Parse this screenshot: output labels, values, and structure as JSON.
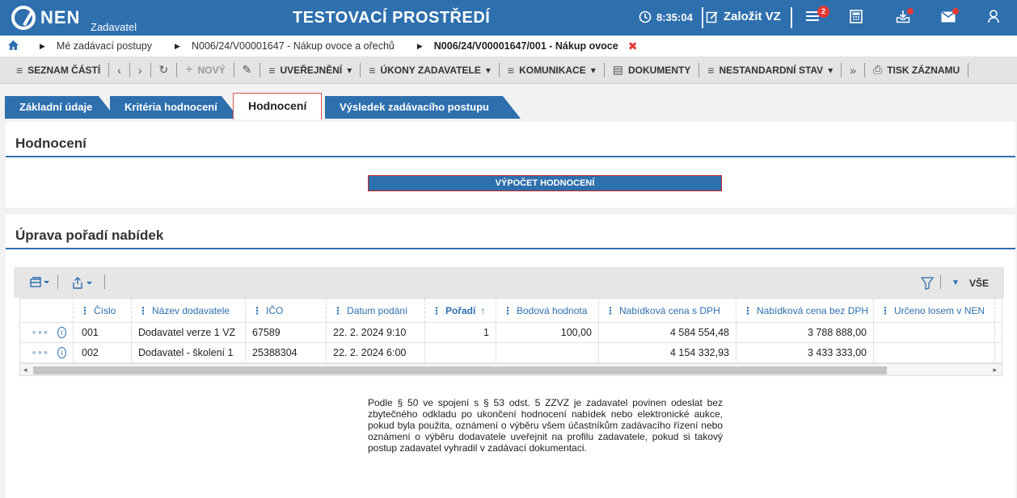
{
  "header": {
    "logo_text": "NEN",
    "logo_sub": "Zadavatel",
    "env_title": "TESTOVACÍ PROSTŘEDÍ",
    "clock": "8:35:04",
    "create_label": "Založit VZ",
    "notification_count": "2"
  },
  "breadcrumb": {
    "items": [
      {
        "label": "Mé zadávací postupy"
      },
      {
        "label": "N006/24/V00001647 - Nákup ovoce a ořechů"
      },
      {
        "label": "N006/24/V00001647/001 - Nákup ovoce"
      }
    ]
  },
  "toolbar": {
    "seznam_casti": "SEZNAM ČÁSTÍ",
    "novy": "NOVÝ",
    "uverejneni": "UVEŘEJNĚNÍ",
    "ukony": "ÚKONY ZADAVATELE",
    "komunikace": "KOMUNIKACE",
    "dokumenty": "DOKUMENTY",
    "nestandardni": "NESTANDARDNÍ STAV",
    "tisk": "TISK ZÁZNAMU"
  },
  "tabs": [
    {
      "label": "Základní údaje"
    },
    {
      "label": "Kritéria hodnocení"
    },
    {
      "label": "Hodnocení"
    },
    {
      "label": "Výsledek zadávacího postupu"
    }
  ],
  "panel_eval": {
    "title": "Hodnocení",
    "calc_button": "VÝPOČET HODNOCENÍ"
  },
  "panel_order": {
    "title": "Úprava pořadí nabídek",
    "filter_all": "VŠE"
  },
  "grid": {
    "columns": [
      "Číslo",
      "Název dodavatele",
      "IČO",
      "Datum podání",
      "Pořadí",
      "Bodová hodnota",
      "Nabídková cena s DPH",
      "Nabídková cena bez DPH",
      "Určeno losem v NEN"
    ],
    "sort_indicator": "↑",
    "rows": [
      {
        "cislo": "001",
        "nazev": "Dodavatel verze 1 VZ",
        "ico": "67589",
        "datum": "22. 2. 2024 9:10",
        "poradi": "1",
        "body": "100,00",
        "cena_s": "4 584 554,48",
        "cena_bez": "3 788 888,00",
        "los": ""
      },
      {
        "cislo": "002",
        "nazev": "Dodavatel - školení 1",
        "ico": "25388304",
        "datum": "22. 2. 2024 6:00",
        "poradi": "",
        "body": "",
        "cena_s": "4 154 332,93",
        "cena_bez": "3 433 333,00",
        "los": ""
      }
    ]
  },
  "legal_text": "Podle § 50 ve spojení s § 53 odst. 5 ZZVZ je zadavatel povinen odeslat bez zbytečného odkladu po ukončení hodnocení nabídek nebo elektronické aukce, pokud byla použita, oznámení o výběru všem účastníkům zadávacího řízení nebo oznámení o výběru dodavatele uveřejnit na profilu zadavatele, pokud si takový postup zadavatel vyhradil v zadávací dokumentaci.",
  "colors": {
    "primary": "#2e6fae",
    "alert": "#e53935"
  }
}
